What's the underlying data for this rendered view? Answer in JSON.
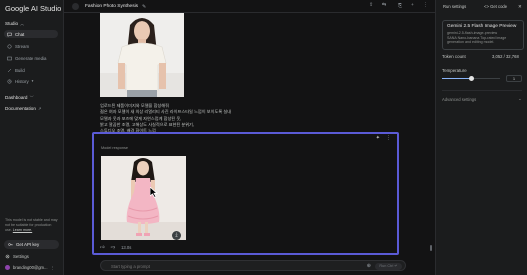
{
  "app": {
    "logo": "Google AI Studio"
  },
  "sidebar": {
    "studio_section": "Studio",
    "items": [
      {
        "label": "Chat",
        "icon": "chat-icon",
        "active": true
      },
      {
        "label": "Stream",
        "icon": "stream-icon",
        "active": false
      },
      {
        "label": "Generate media",
        "icon": "media-icon",
        "active": false
      },
      {
        "label": "Build",
        "icon": "build-icon",
        "active": false
      },
      {
        "label": "History",
        "icon": "history-icon",
        "active": false
      }
    ],
    "dashboard_section": "Dashboard",
    "documentation": "Documentation",
    "warning_text": "This model is not stable and may not be suitable for production use.",
    "learn_more": "Learn more.",
    "get_api_key": "Get API key",
    "settings": "Settings",
    "account": "branding00@gm..."
  },
  "topbar": {
    "title": "Fashion Photo Synthesis"
  },
  "chat": {
    "user_text_lines": [
      "업로드된 제품이미지와 모델을 합성해줘",
      "젊은 여자 모델이 새 의상 리얼리티 사진 라이프스타일 느낌이 보이도록 실내",
      "모델과 옷과 포즈에 맞게 자연스럽게 합성된 옷,",
      "밝고 깔끔한 조명, 고해상도 사실적으로 표현된 분위기,",
      "스튜디오 조명, 배경 화이트 느낌"
    ],
    "model_response_label": "Model response",
    "token_count": "13.0s",
    "prompt_placeholder": "Start typing a prompt",
    "run_label": "Run Ctrl ↵"
  },
  "right_panel": {
    "title": "Run settings",
    "get_code": "Get code",
    "model_name": "Gemini 2.5 Flash Image Preview",
    "model_id": "gemini-2.5-flash-image-preview",
    "model_desc": "SANA Nano-banana Top-rated image generation and editing model.",
    "token_label": "Token count",
    "token_value": "3,052 / 32,768",
    "temperature_label": "Temperature",
    "temperature_value": "1",
    "temperature_fraction": 0.5,
    "advanced_settings": "Advanced settings"
  },
  "colors": {
    "accent": "#5b5bd6",
    "background": "#131314",
    "sidebar": "#1b1c1d"
  }
}
